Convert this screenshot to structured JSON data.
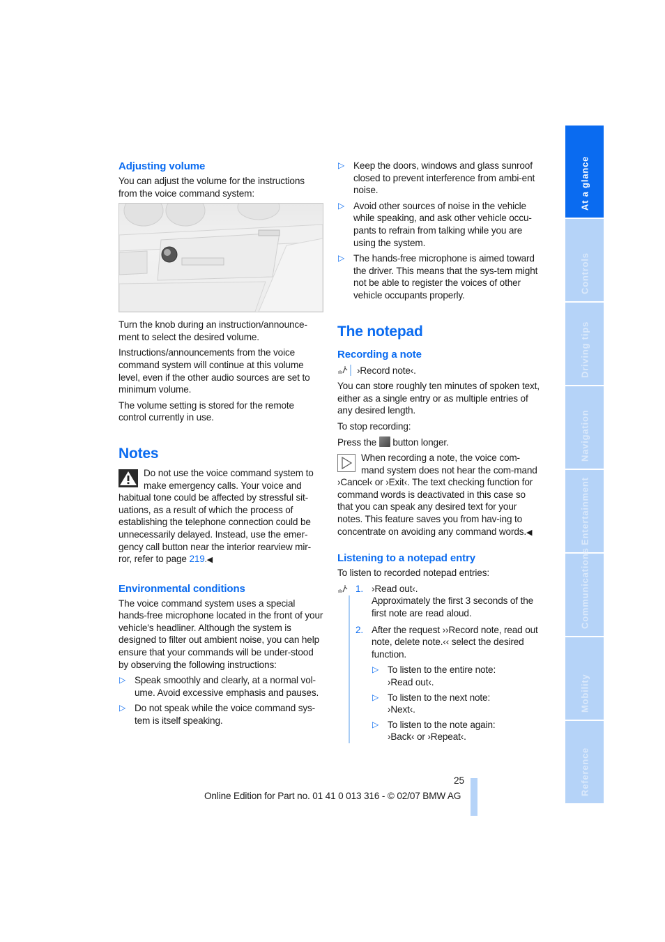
{
  "left_column": {
    "adjusting_volume": {
      "heading": "Adjusting volume",
      "intro": "You can adjust the volume for the instructions from the voice command system:",
      "figure_alt": "Dashboard audio unit with volume knob",
      "p1": "Turn the knob during an instruction/announce-ment to select the desired volume.",
      "p2": "Instructions/announcements from the voice command system will continue at this volume level, even if the other audio sources are set to minimum volume.",
      "p3": "The volume setting is stored for the remote control currently in use."
    },
    "notes": {
      "heading": "Notes",
      "warning_text": "Do not use the voice command system to make emergency calls. Your voice and habitual tone could be affected by stressful sit-uations, as a result of which the process of establishing the telephone connection could be unnecessarily delayed. Instead, use the emer-gency call button near the interior rearview mir-ror, refer to page ",
      "page_link": "219",
      "end_mark": ".◀"
    },
    "environmental": {
      "heading": "Environmental conditions",
      "intro": "The voice command system uses a special hands-free microphone located in the front of your vehicle's headliner. Although the system is designed to filter out ambient noise, you can help ensure that your commands will be under-stood by observing the following instructions:",
      "bullets": [
        "Speak smoothly and clearly, at a normal vol-ume. Avoid excessive emphasis and pauses.",
        "Do not speak while the voice command sys-tem is itself speaking."
      ]
    }
  },
  "right_column": {
    "bullets_continued": [
      "Keep the doors, windows and glass sunroof closed to prevent interference from ambi-ent noise.",
      "Avoid other sources of noise in the vehicle while speaking, and ask other vehicle occu-pants to refrain from talking while you are using the system.",
      "The hands-free microphone is aimed toward the driver. This means that the sys-tem might not be able to register the voices of other vehicle occupants properly."
    ],
    "notepad": {
      "heading": "The notepad",
      "recording": {
        "heading": "Recording a note",
        "command": "›Record note‹.",
        "p1": "You can store roughly ten minutes of spoken text, either as a single entry or as multiple entries of any desired length.",
        "p2": "To stop recording:",
        "press_pre": "Press the ",
        "press_post": " button longer.",
        "note_text": "When recording a note, the voice com-mand system does not hear the com-mand ›Cancel‹ or ›Exit‹. The text checking function for command words is deactivated in this case so that you can speak any desired text for your notes. This feature saves you from hav-ing to concentrate on avoiding any command words.",
        "end_mark": "◀"
      },
      "listening": {
        "heading": "Listening to a notepad entry",
        "intro": "To listen to recorded notepad entries:",
        "steps": [
          {
            "num": "1.",
            "text": "›Read out‹.",
            "detail": "Approximately the first 3 seconds of the first note are read aloud."
          },
          {
            "num": "2.",
            "text": "After the request ››Record note, read out note, delete note.‹‹ select the desired function."
          }
        ],
        "sub_bullets": [
          {
            "line1": "To listen to the entire note:",
            "line2": "›Read out‹."
          },
          {
            "line1": "To listen to the next note:",
            "line2": "›Next‹."
          },
          {
            "line1": "To listen to the note again:",
            "line2": "›Back‹ or ›Repeat‹."
          }
        ]
      }
    }
  },
  "sidebar": {
    "tabs": [
      {
        "label": "At a glance",
        "active": true
      },
      {
        "label": "Controls"
      },
      {
        "label": "Driving tips"
      },
      {
        "label": "Navigation"
      },
      {
        "label": "Entertainment"
      },
      {
        "label": "Communications"
      },
      {
        "label": "Mobility"
      },
      {
        "label": "Reference"
      }
    ]
  },
  "footer": {
    "page_number": "25",
    "edition": "Online Edition for Part no. 01 41 0 013 316 - © 02/07 BMW AG"
  },
  "colors": {
    "accent": "#0a6bf0",
    "tab_inactive": "#b5d3f8"
  },
  "icons": {
    "bullet": "▷",
    "warning": "warning-triangle-icon",
    "note": "note-play-icon",
    "voice": "microphone-voice-icon"
  }
}
